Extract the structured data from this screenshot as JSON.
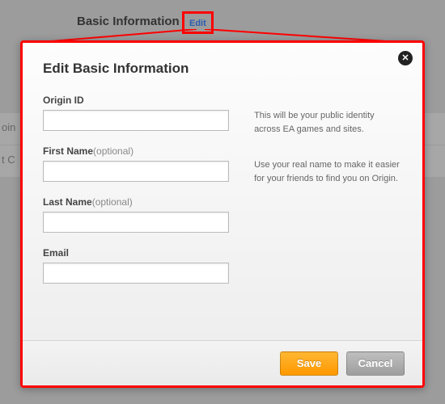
{
  "header": {
    "section_title": "Basic Information",
    "edit_link": "Edit"
  },
  "modal": {
    "title": "Edit Basic Information",
    "close_glyph": "✕",
    "fields": {
      "origin_id": {
        "label": "Origin ID",
        "value": ""
      },
      "first_name": {
        "label": "First Name",
        "optional": "(optional)",
        "value": ""
      },
      "last_name": {
        "label": "Last Name",
        "optional": "(optional)",
        "value": ""
      },
      "email": {
        "label": "Email",
        "value": ""
      }
    },
    "help": {
      "origin_id": "This will be your public identity across EA games and sites.",
      "name": "Use your real name to make it easier for your friends to find you on Origin."
    },
    "buttons": {
      "save": "Save",
      "cancel": "Cancel"
    }
  },
  "sidebar_fragments": {
    "item1": "oin",
    "item2": "t C"
  }
}
